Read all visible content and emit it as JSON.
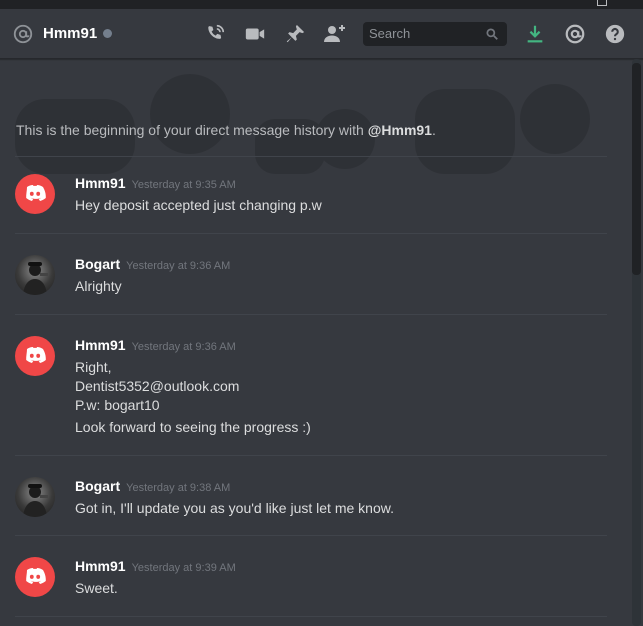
{
  "header": {
    "channel_name": "Hmm91",
    "search_placeholder": "Search"
  },
  "intro": {
    "text": "This is the beginning of your direct message history with ",
    "mention": "@Hmm91",
    "end": "."
  },
  "messages": [
    {
      "author": "Hmm91",
      "avatar": "discord-logo-icon",
      "timestamp": "Yesterday at 9:35 AM",
      "lines": [
        "Hey deposit accepted just changing p.w"
      ]
    },
    {
      "author": "Bogart",
      "avatar": "user-photo",
      "timestamp": "Yesterday at 9:36 AM",
      "lines": [
        "Alrighty"
      ]
    },
    {
      "author": "Hmm91",
      "avatar": "discord-logo-icon",
      "timestamp": "Yesterday at 9:36 AM",
      "lines": [
        "Right,",
        "Dentist5352@outlook.com",
        "P.w: bogart10",
        "Look forward to seeing the progress :)"
      ]
    },
    {
      "author": "Bogart",
      "avatar": "user-photo",
      "timestamp": "Yesterday at 9:38 AM",
      "lines": [
        "Got in, I'll update you as you'd like just let me know."
      ]
    },
    {
      "author": "Hmm91",
      "avatar": "discord-logo-icon",
      "timestamp": "Yesterday at 9:39 AM",
      "lines": [
        "Sweet."
      ]
    }
  ],
  "colors": {
    "background": "#36393f",
    "discord_red": "#f04747",
    "download_green": "#43b581",
    "status_offline": "#747f8d"
  }
}
